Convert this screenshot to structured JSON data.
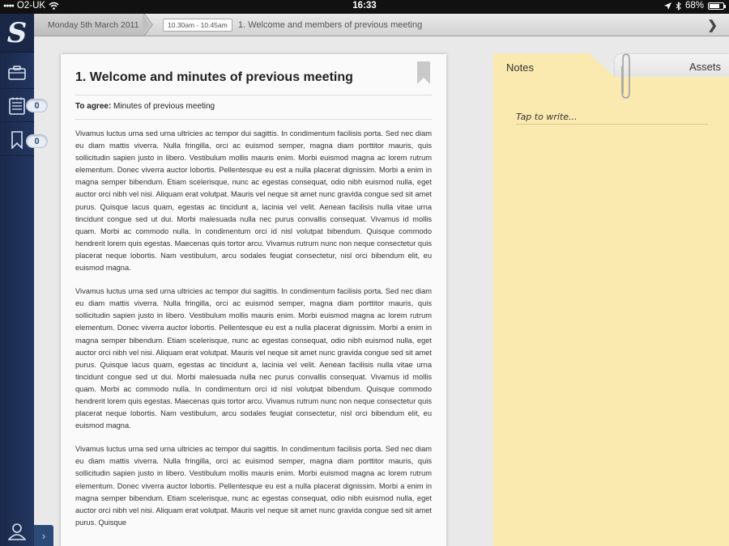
{
  "status": {
    "carrier": "O2-UK",
    "time": "16:33",
    "battery": "68%",
    "battery_level": 0.68
  },
  "sidebar": {
    "logo": "S",
    "items": [
      {
        "name": "briefcase",
        "icon": "briefcase-icon"
      },
      {
        "name": "agenda",
        "icon": "list-icon",
        "badge": "0"
      },
      {
        "name": "bookmarks",
        "icon": "bookmark-icon",
        "badge": "0"
      }
    ],
    "user_icon": "user-icon"
  },
  "breadcrumb": {
    "date": "Monday 5th March 2011",
    "time_range": "10.30am - 10.45am",
    "item_title": "1. Welcome and members of previous meeting"
  },
  "document": {
    "title": "1. Welcome and minutes of previous meeting",
    "agree_label": "To agree:",
    "agree_text": " Minutes of previous meeting",
    "paragraphs": [
      "Vivamus luctus urna sed urna ultricies ac tempor dui sagittis. In condimentum facilisis porta. Sed nec diam eu diam mattis viverra. Nulla fringilla, orci ac euismod semper, magna diam porttitor mauris, quis sollicitudin sapien justo in libero. Vestibulum mollis mauris enim. Morbi euismod magna ac lorem rutrum elementum. Donec viverra auctor lobortis. Pellentesque eu est a nulla placerat dignissim. Morbi a enim in magna semper bibendum. Etiam scelerisque, nunc ac egestas consequat, odio nibh euismod nulla, eget auctor orci nibh vel nisi. Aliquam erat volutpat. Mauris vel neque sit amet nunc gravida congue sed sit amet purus. Quisque lacus quam, egestas ac tincidunt a, lacinia vel velit. Aenean facilisis nulla vitae urna tincidunt congue sed ut dui. Morbi malesuada nulla nec purus convallis consequat. Vivamus id mollis quam. Morbi ac commodo nulla. In condimentum orci id nisl volutpat bibendum. Quisque commodo hendrerit lorem quis egestas. Maecenas quis tortor arcu. Vivamus rutrum nunc non neque consectetur quis placerat neque lobortis. Nam vestibulum, arcu sodales feugiat consectetur, nisl orci bibendum elit, eu euismod magna.",
      "Vivamus luctus urna sed urna ultricies ac tempor dui sagittis. In condimentum facilisis porta. Sed nec diam eu diam mattis viverra. Nulla fringilla, orci ac euismod semper, magna diam porttitor mauris, quis sollicitudin sapien justo in libero. Vestibulum mollis mauris enim. Morbi euismod magna ac lorem rutrum elementum. Donec viverra auctor lobortis. Pellentesque eu est a nulla placerat dignissim. Morbi a enim in magna semper bibendum. Etiam scelerisque, nunc ac egestas consequat, odio nibh euismod nulla, eget auctor orci nibh vel nisi. Aliquam erat volutpat. Mauris vel neque sit amet nunc gravida congue sed sit amet purus. Quisque lacus quam, egestas ac tincidunt a, lacinia vel velit. Aenean facilisis nulla vitae urna tincidunt congue sed ut dui. Morbi malesuada nulla nec purus convallis consequat. Vivamus id mollis quam. Morbi ac commodo nulla. In condimentum orci id nisl volutpat bibendum. Quisque commodo hendrerit lorem quis egestas. Maecenas quis tortor arcu. Vivamus rutrum nunc non neque consectetur quis placerat neque lobortis. Nam vestibulum, arcu sodales feugiat consectetur, nisl orci bibendum elit, eu euismod magna.",
      "Vivamus luctus urna sed urna ultricies ac tempor dui sagittis. In condimentum facilisis porta. Sed nec diam eu diam mattis viverra. Nulla fringilla, orci ac euismod semper, magna diam porttitor mauris, quis sollicitudin sapien justo in libero. Vestibulum mollis mauris enim. Morbi euismod magna ac lorem rutrum elementum. Donec viverra auctor lobortis. Pellentesque eu est a nulla placerat dignissim. Morbi a enim in magna semper bibendum. Etiam scelerisque, nunc ac egestas consequat, odio nibh euismod nulla, eget auctor orci nibh vel nisi. Aliquam erat volutpat. Mauris vel neque sit amet nunc gravida congue sed sit amet purus. Quisque"
    ]
  },
  "notes": {
    "notes_tab": "Notes",
    "assets_tab": "Assets",
    "placeholder": "Tap to write..."
  },
  "colors": {
    "sidebar": "#223660",
    "notes_paper": "#faeab0",
    "badge_text": "#2e4c7e"
  }
}
